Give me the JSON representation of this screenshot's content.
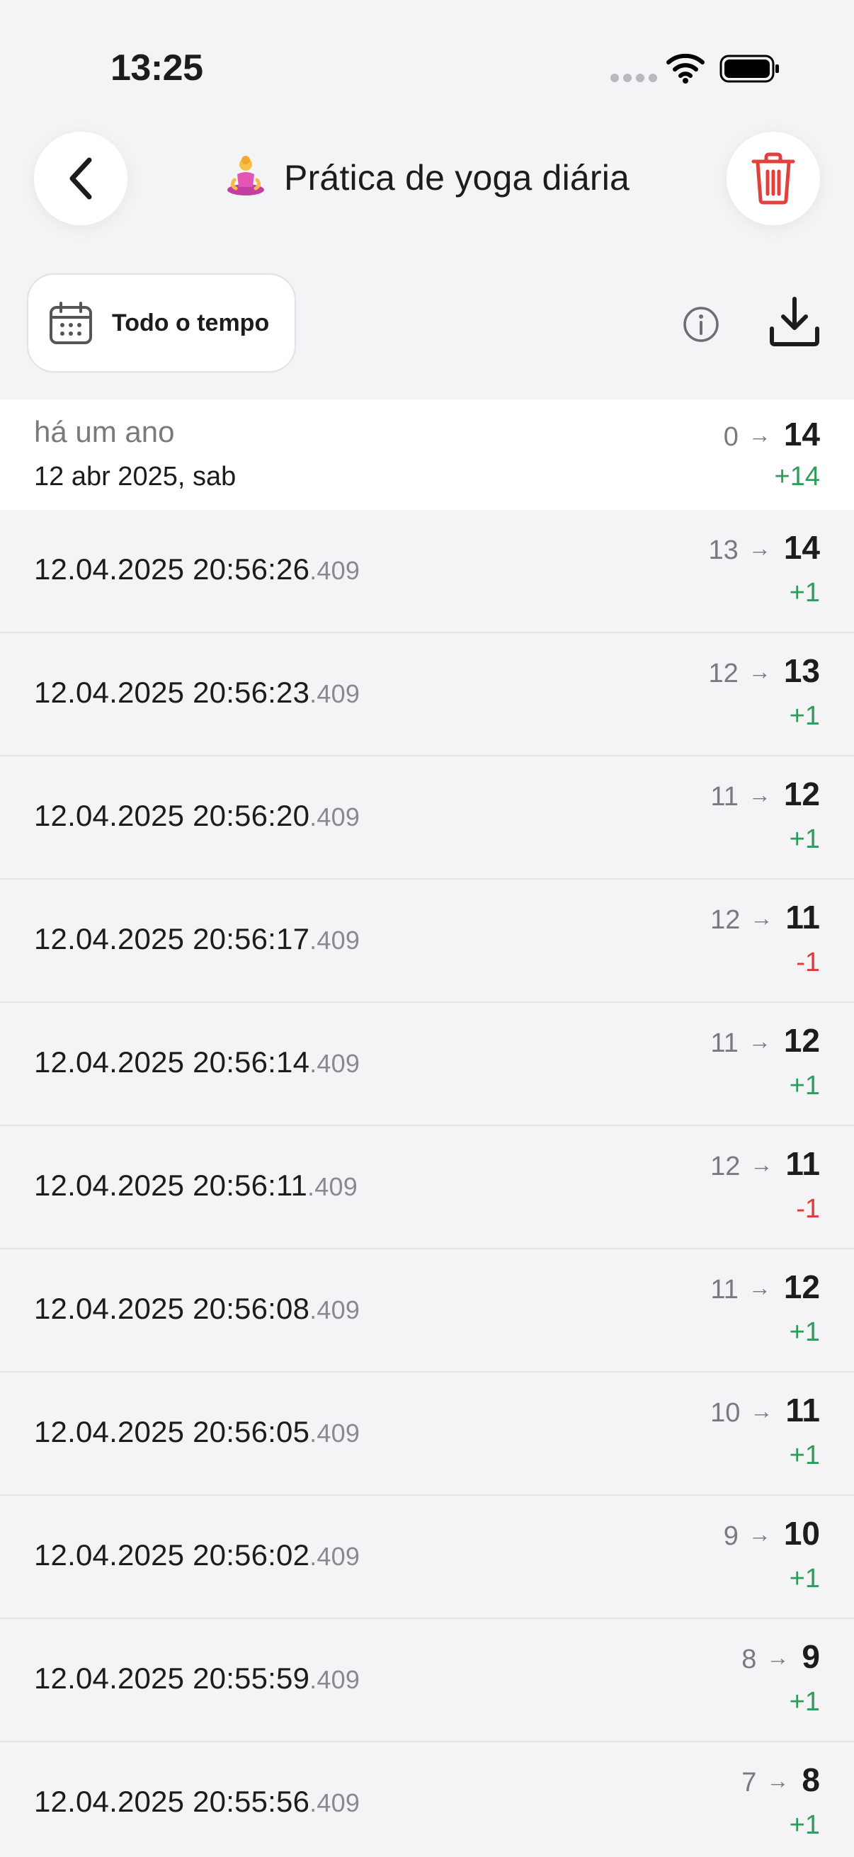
{
  "status_bar": {
    "time": "13:25"
  },
  "header": {
    "title": "Prática de yoga diária",
    "icon": "person-in-lotus-position-icon"
  },
  "filter": {
    "period_label": "Todo o tempo"
  },
  "summary": {
    "relative": "há um ano",
    "date": "12 abr 2025, sab",
    "from": "0",
    "to": "14",
    "delta": "+14"
  },
  "colors": {
    "positive": "#2e9c5a",
    "negative": "#de3b3b",
    "delete": "#e0413d"
  },
  "entries": [
    {
      "time": "12.04.2025 20:56:26",
      "ms": ".409",
      "from": "13",
      "to": "14",
      "delta": "+1"
    },
    {
      "time": "12.04.2025 20:56:23",
      "ms": ".409",
      "from": "12",
      "to": "13",
      "delta": "+1"
    },
    {
      "time": "12.04.2025 20:56:20",
      "ms": ".409",
      "from": "11",
      "to": "12",
      "delta": "+1"
    },
    {
      "time": "12.04.2025 20:56:17",
      "ms": ".409",
      "from": "12",
      "to": "11",
      "delta": "-1"
    },
    {
      "time": "12.04.2025 20:56:14",
      "ms": ".409",
      "from": "11",
      "to": "12",
      "delta": "+1"
    },
    {
      "time": "12.04.2025 20:56:11",
      "ms": ".409",
      "from": "12",
      "to": "11",
      "delta": "-1"
    },
    {
      "time": "12.04.2025 20:56:08",
      "ms": ".409",
      "from": "11",
      "to": "12",
      "delta": "+1"
    },
    {
      "time": "12.04.2025 20:56:05",
      "ms": ".409",
      "from": "10",
      "to": "11",
      "delta": "+1"
    },
    {
      "time": "12.04.2025 20:56:02",
      "ms": ".409",
      "from": "9",
      "to": "10",
      "delta": "+1"
    },
    {
      "time": "12.04.2025 20:55:59",
      "ms": ".409",
      "from": "8",
      "to": "9",
      "delta": "+1"
    },
    {
      "time": "12.04.2025 20:55:56",
      "ms": ".409",
      "from": "7",
      "to": "8",
      "delta": "+1"
    }
  ]
}
